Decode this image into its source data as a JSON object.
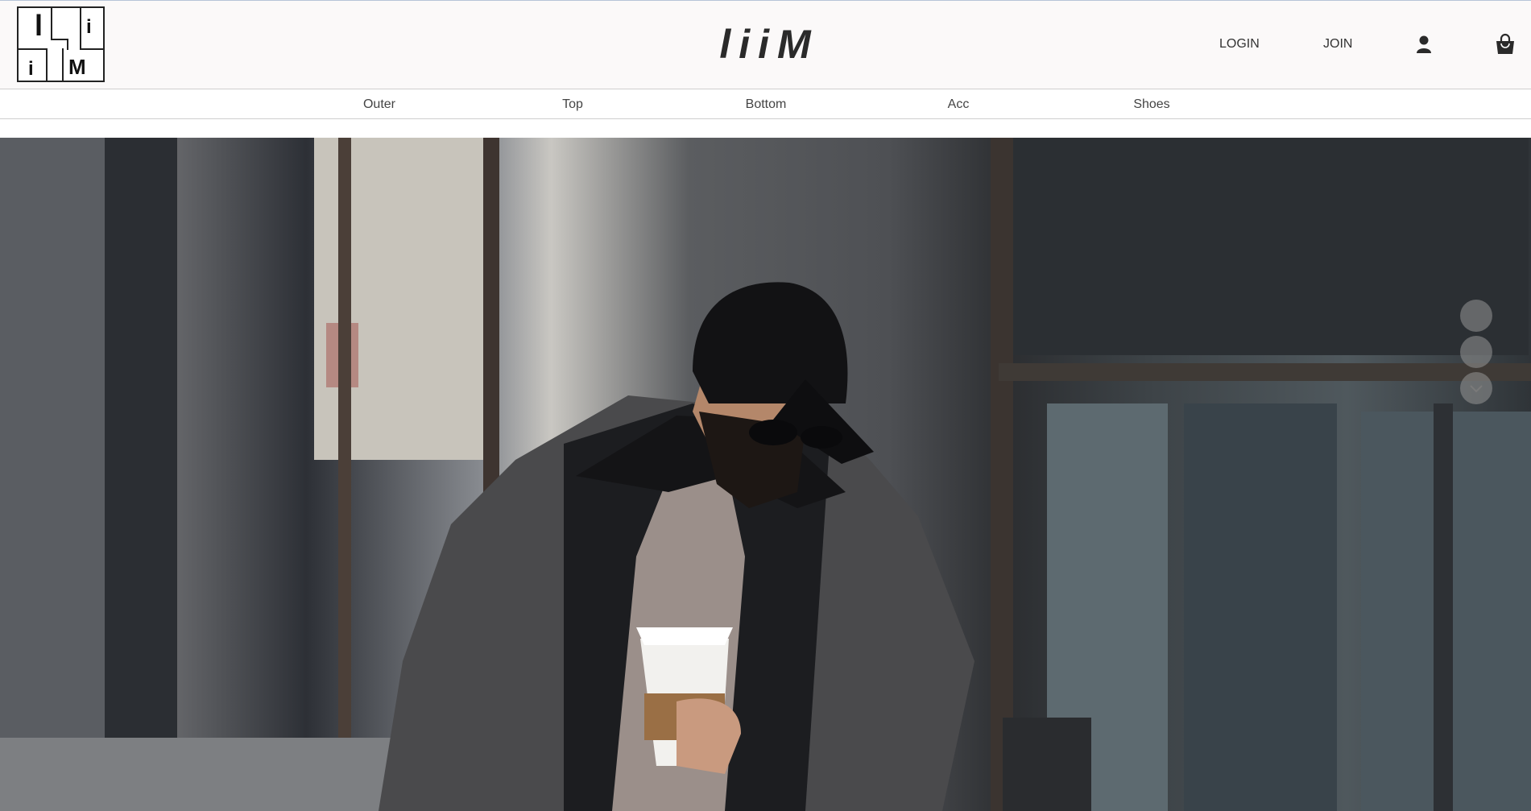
{
  "header": {
    "logo_letters": [
      "l",
      "i",
      "i",
      "M"
    ],
    "brand": "liiM",
    "login_label": "LOGIN",
    "join_label": "JOIN",
    "user_icon": "user-icon",
    "cart_icon": "shopping-bag-icon"
  },
  "nav": {
    "items": [
      {
        "label": "Outer"
      },
      {
        "label": "Top"
      },
      {
        "label": "Bottom"
      },
      {
        "label": "Acc"
      },
      {
        "label": "Shoes"
      }
    ]
  },
  "hero": {
    "slide_indicators": 2,
    "scroll_down_icon": "chevron-down-icon"
  },
  "colors": {
    "header_bg": "#fbf9f9",
    "text": "#333333",
    "indicator": "#969696"
  }
}
